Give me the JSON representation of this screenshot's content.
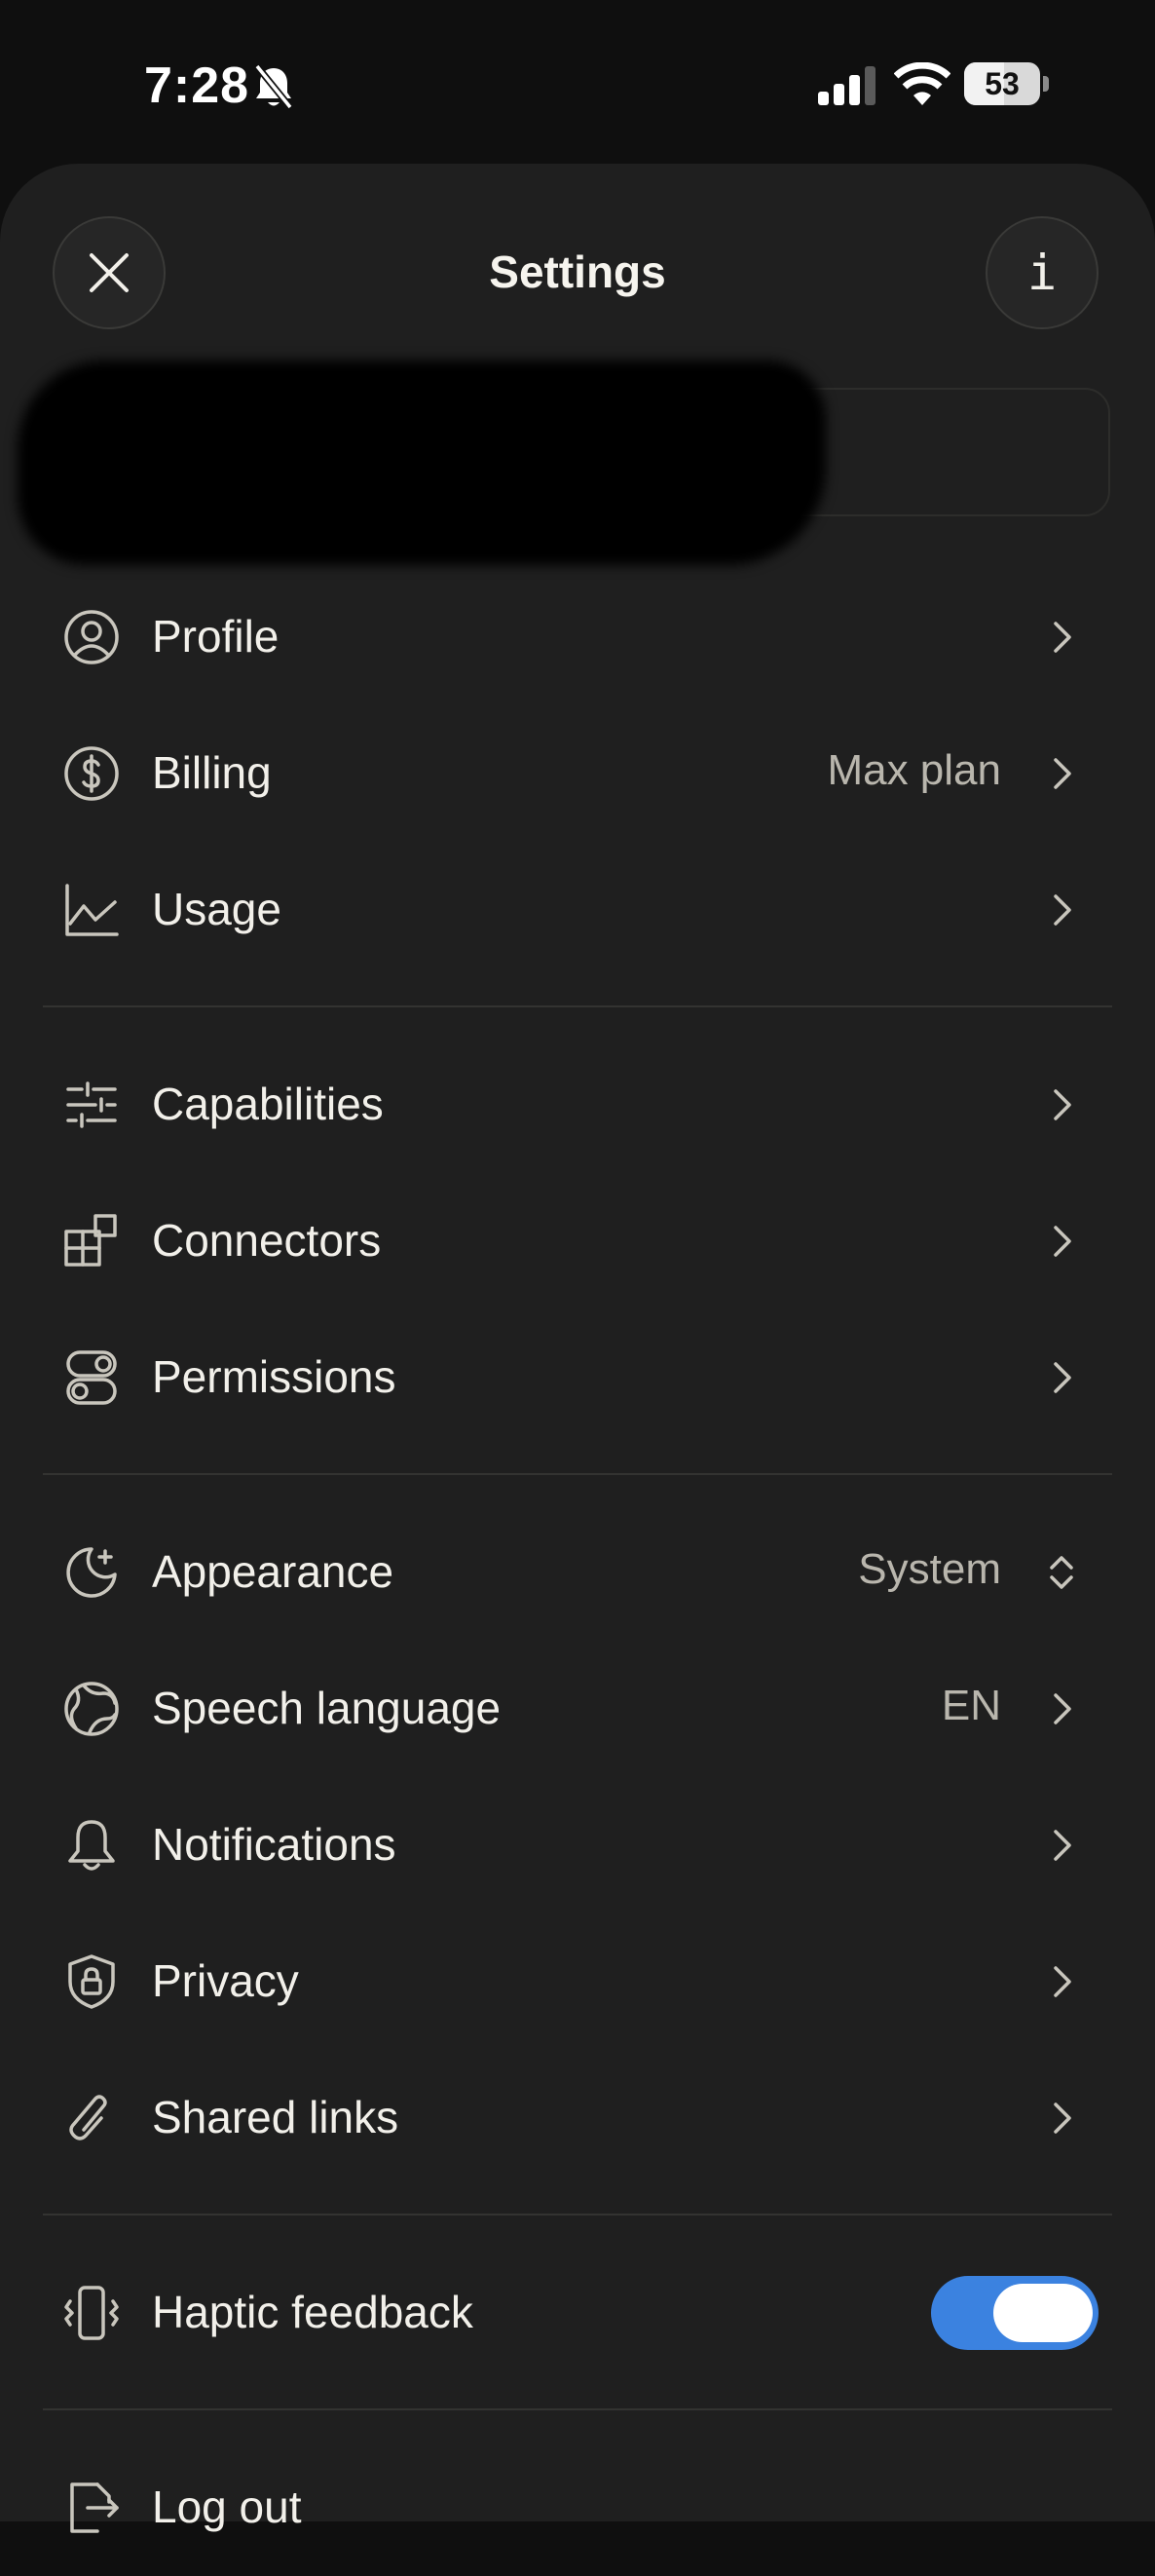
{
  "status_bar": {
    "time": "7:28",
    "battery": "53",
    "battery_level": 0.53
  },
  "header": {
    "title": "Settings",
    "close_icon": "close-icon",
    "info_icon": "info-icon",
    "info_glyph": "i"
  },
  "menu": {
    "profile": {
      "label": "Profile",
      "icon": "user-circle-icon"
    },
    "billing": {
      "label": "Billing",
      "value": "Max plan",
      "icon": "dollar-circle-icon"
    },
    "usage": {
      "label": "Usage",
      "icon": "line-chart-icon"
    },
    "capabilities": {
      "label": "Capabilities",
      "icon": "sliders-icon"
    },
    "connectors": {
      "label": "Connectors",
      "icon": "connectors-icon"
    },
    "permissions": {
      "label": "Permissions",
      "icon": "toggles-icon"
    },
    "appearance": {
      "label": "Appearance",
      "value": "System",
      "icon": "moon-icon"
    },
    "speech_language": {
      "label": "Speech language",
      "value": "EN",
      "icon": "globe-icon"
    },
    "notifications": {
      "label": "Notifications",
      "icon": "bell-icon"
    },
    "privacy": {
      "label": "Privacy",
      "icon": "shield-lock-icon"
    },
    "shared_links": {
      "label": "Shared links",
      "icon": "paperclip-icon"
    },
    "haptic_feedback": {
      "label": "Haptic feedback",
      "icon": "phone-vibrate-icon",
      "enabled": true
    },
    "log_out": {
      "label": "Log out",
      "icon": "logout-icon"
    }
  },
  "colors": {
    "toggle_on": "#3b82e0",
    "sheet_bg": "#1f1f1f",
    "text_primary": "#f2f0ea",
    "text_secondary": "#b9b6ad"
  }
}
